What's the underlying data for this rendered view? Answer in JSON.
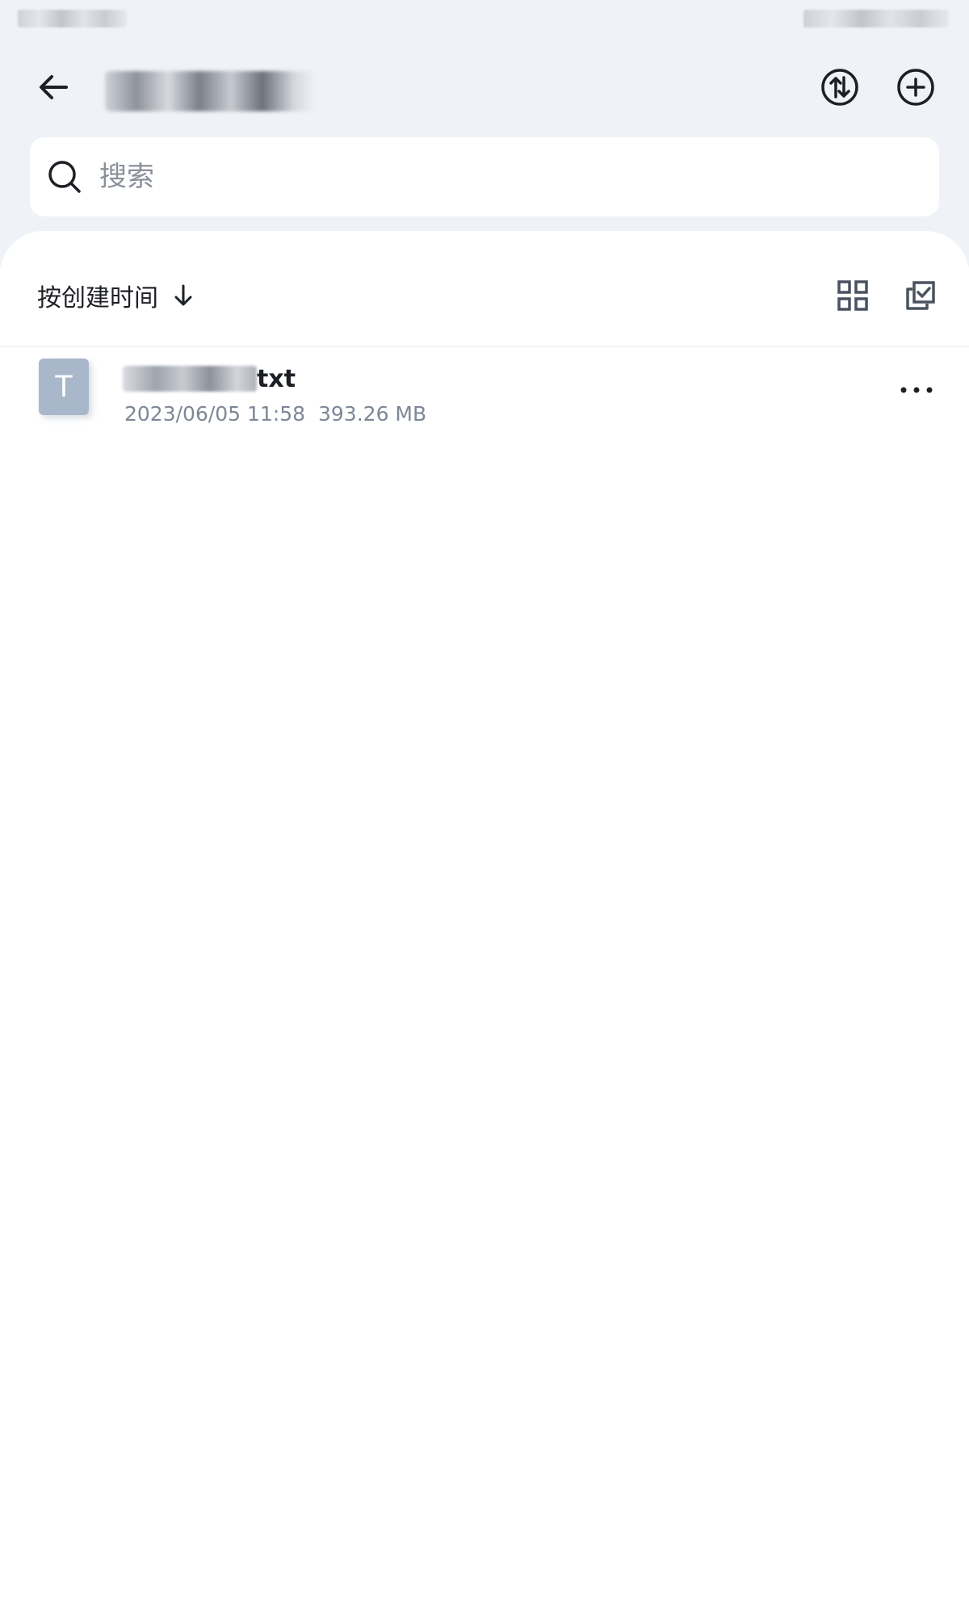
{
  "status_bar": {
    "left_text": "",
    "right_text": ""
  },
  "header": {
    "title": "",
    "back_icon": "back-arrow-icon",
    "transfer_icon": "transfer-icon",
    "add_icon": "add-circle-icon"
  },
  "search": {
    "placeholder": "搜索",
    "value": "",
    "icon": "search-icon"
  },
  "toolbar": {
    "sort_label": "按创建时间",
    "sort_icon": "arrow-down-icon",
    "grid_view_icon": "grid-view-icon",
    "multi_select_icon": "multi-select-icon"
  },
  "files": [
    {
      "type_letter": "T",
      "name_visible": "txt",
      "date": "2023/06/05 11:58",
      "size": "393.26 MB",
      "more_icon": "more-icon"
    }
  ],
  "colors": {
    "header_bg": "#eff3f8",
    "content_bg": "#ffffff",
    "file_icon_bg": "#a9b7ca",
    "text_primary": "#1c1f24",
    "text_secondary": "#7d8796"
  }
}
